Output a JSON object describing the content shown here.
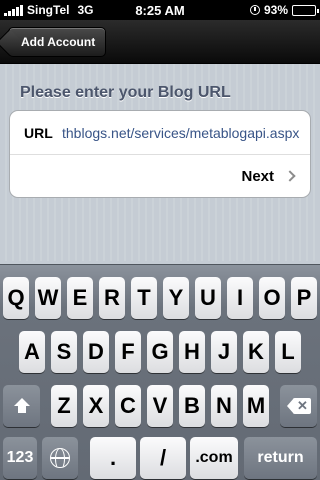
{
  "status_bar": {
    "carrier": "SingTel",
    "network": "3G",
    "time": "8:25 AM",
    "battery": "93%",
    "battery_level": 0.93
  },
  "nav": {
    "back_label": "Add Account"
  },
  "form": {
    "header": "Please enter your Blog URL",
    "url_label": "URL",
    "url_value": "thblogs.net/services/metablogapi.aspx",
    "next_label": "Next"
  },
  "keyboard": {
    "row1": [
      "Q",
      "W",
      "E",
      "R",
      "T",
      "Y",
      "U",
      "I",
      "O",
      "P"
    ],
    "row2": [
      "A",
      "S",
      "D",
      "F",
      "G",
      "H",
      "J",
      "K",
      "L"
    ],
    "row3": [
      "Z",
      "X",
      "C",
      "V",
      "B",
      "N",
      "M"
    ],
    "numbers_label": "123",
    "dot_label": ".",
    "slash_label": "/",
    "com_label": ".com",
    "return_label": "return"
  },
  "colors": {
    "accent_link": "#385487",
    "section_header": "#4c566c"
  }
}
